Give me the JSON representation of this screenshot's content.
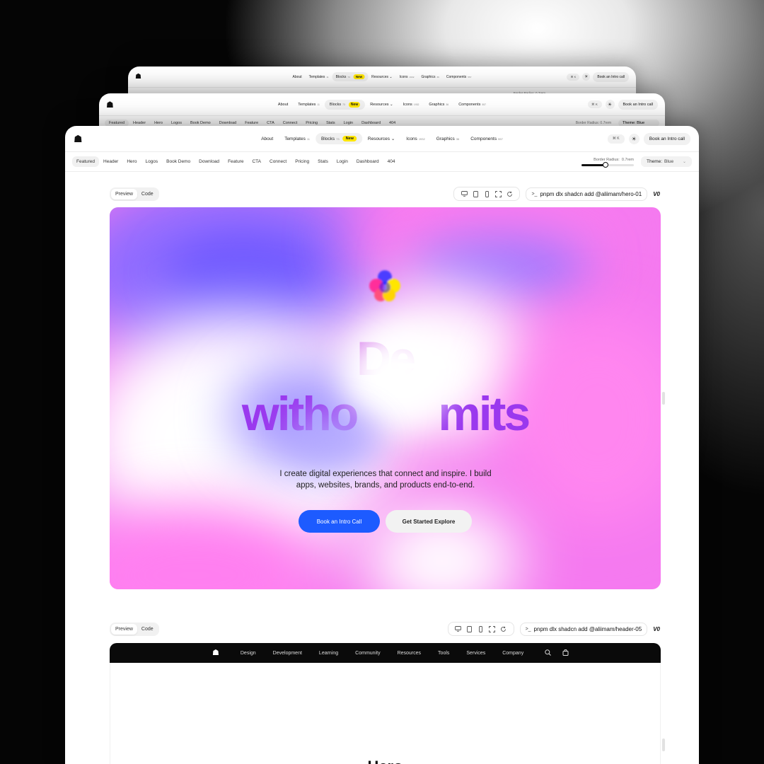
{
  "nav": {
    "about": "About",
    "templates": "Templates",
    "templates_count": "11",
    "blocks": "Blocks",
    "blocks_count": "73",
    "new_badge": "New",
    "resources": "Resources",
    "icons": "Icons",
    "icons_count": "1932",
    "graphics": "Graphics",
    "graphics_count": "36",
    "components": "Components",
    "components_count": "557",
    "kbd": "⌘ K",
    "cta": "Book an Intro call"
  },
  "categories": [
    "Featured",
    "Header",
    "Hero",
    "Logos",
    "Book Demo",
    "Download",
    "Feature",
    "CTA",
    "Connect",
    "Pricing",
    "Stats",
    "Login",
    "Dashboard",
    "404"
  ],
  "back_categories": [
    "Featured",
    "Header",
    "Hero",
    "Logos",
    "Book Demo",
    "Download",
    "Feature",
    "CTA",
    "Connect",
    "Pricing",
    "Stats",
    "Login",
    "Dashboard",
    "404"
  ],
  "settings": {
    "border_radius_label": "Border Radius:",
    "border_radius_value": "0.7rem",
    "border_radius_level": 0.46,
    "theme_label": "Theme:",
    "theme_value": "Blue",
    "back_border_radius": "Border Radius: 0.7rem",
    "back_theme": "Theme: Blue"
  },
  "preview1": {
    "preview_tab": "Preview",
    "code_tab": "Code",
    "command": "pnpm dlx shadcn add @aliimam/hero-01",
    "v0": "V0"
  },
  "hero": {
    "title_line1": "De",
    "title_line2a": "witho",
    "title_line2b": "mits",
    "subtitle": "I create digital experiences that connect and inspire. I build apps, websites, brands, and products end-to-end.",
    "primary_cta": "Book an Intro Call",
    "secondary_cta": "Get Started Explore"
  },
  "preview2": {
    "preview_tab": "Preview",
    "code_tab": "Code",
    "command": "pnpm dlx shadcn add @aliimam/header-05",
    "v0": "V0"
  },
  "header_demo": {
    "items": [
      "Design",
      "Development",
      "Learning",
      "Community",
      "Resources",
      "Tools",
      "Services",
      "Company"
    ],
    "section_title": "Hero"
  },
  "colors": {
    "accent_blue": "#1d5bff",
    "badge_yellow": "#ffe600",
    "hero_pink": "#f57af0",
    "hero_purple": "#7b5cff"
  }
}
